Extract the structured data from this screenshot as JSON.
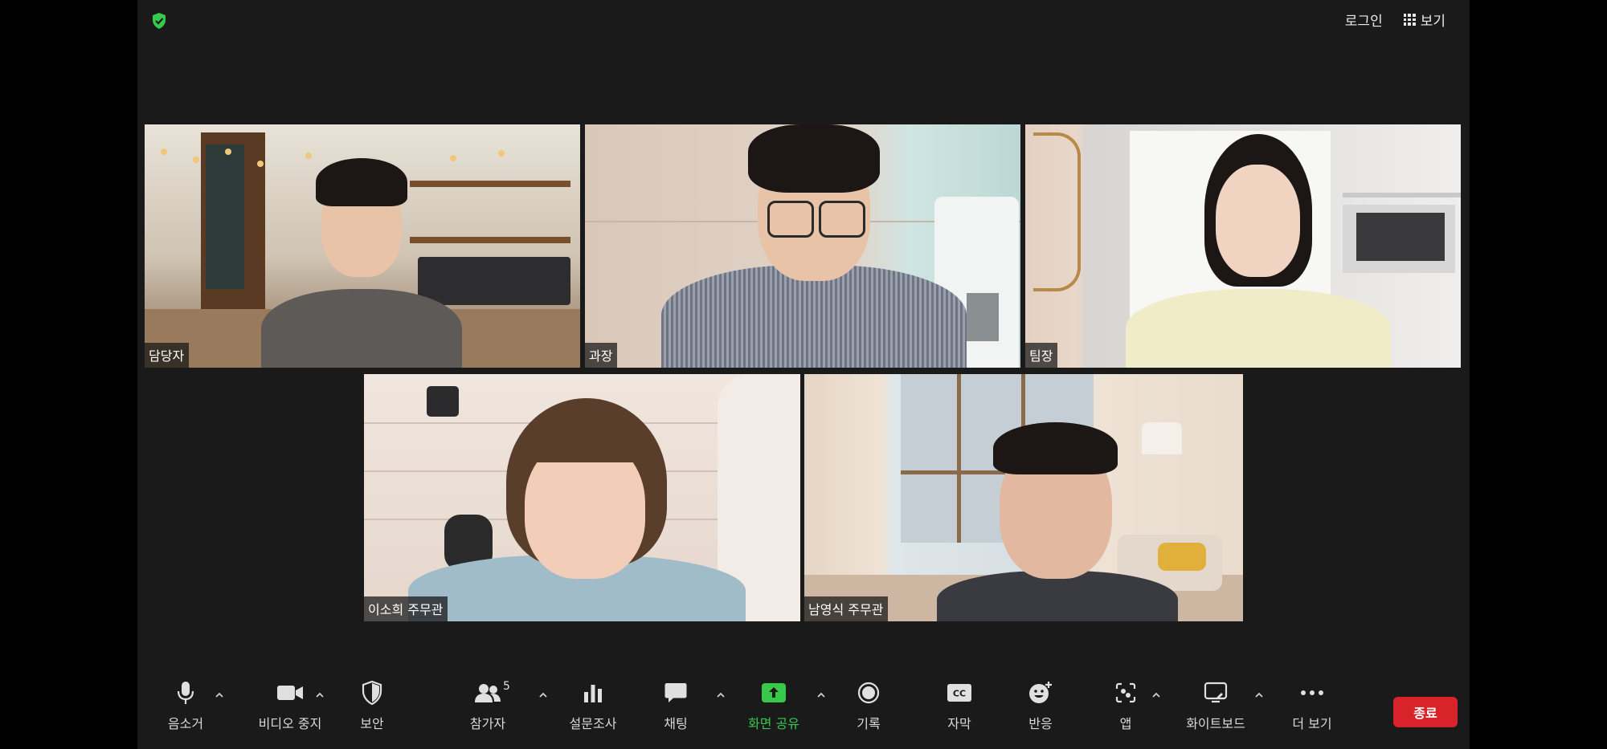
{
  "topbar": {
    "login": "로그인",
    "view": "보기"
  },
  "participants": [
    {
      "name": "담당자"
    },
    {
      "name": "과장"
    },
    {
      "name": "팀장"
    },
    {
      "name": "이소희 주무관"
    },
    {
      "name": "남영식 주무관",
      "active": true
    }
  ],
  "toolbar": {
    "mute": "음소거",
    "stop_video": "비디오 중지",
    "security": "보안",
    "participants": "참가자",
    "participants_count": "5",
    "polls": "설문조사",
    "chat": "채팅",
    "share_screen": "화면 공유",
    "record": "기록",
    "captions": "자막",
    "reactions": "반응",
    "apps": "앱",
    "whiteboard": "화이트보드",
    "more": "더 보기",
    "end": "종료"
  },
  "colors": {
    "accent_green": "#37c94a",
    "end_red": "#d8232a",
    "background": "#1a1a1a"
  }
}
